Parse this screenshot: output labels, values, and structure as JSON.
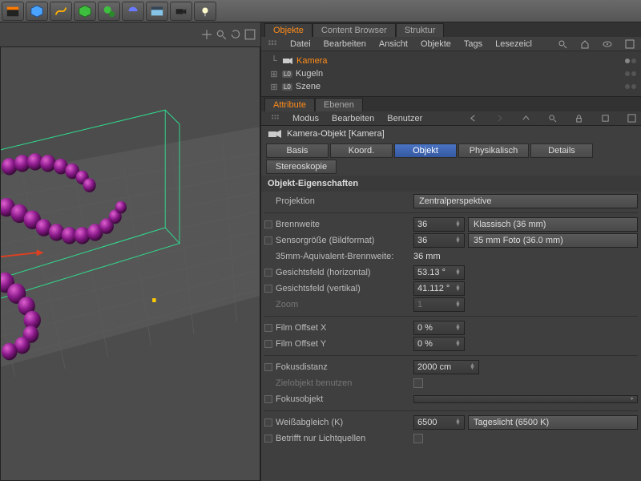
{
  "toolbar_icons": [
    "clapper",
    "cube",
    "link",
    "green-cube",
    "gears",
    "lens",
    "grid",
    "camera",
    "light"
  ],
  "tabs": {
    "objects": "Objekte",
    "content": "Content Browser",
    "structure": "Struktur"
  },
  "obj_menu": [
    "Datei",
    "Bearbeiten",
    "Ansicht",
    "Objekte",
    "Tags",
    "Lesezeicl"
  ],
  "objlist": [
    {
      "name": "Kamera",
      "selected": true,
      "icon": "camera",
      "layer": ""
    },
    {
      "name": "Kugeln",
      "selected": false,
      "icon": "null",
      "layer": "L0"
    },
    {
      "name": "Szene",
      "selected": false,
      "icon": "null",
      "layer": "L0"
    }
  ],
  "attr_tabs": {
    "attribute": "Attribute",
    "ebenen": "Ebenen"
  },
  "attr_menu": [
    "Modus",
    "Bearbeiten",
    "Benutzer"
  ],
  "obj_title": "Kamera-Objekt [Kamera]",
  "subtabs": {
    "basis": "Basis",
    "koord": "Koord.",
    "objekt": "Objekt",
    "phys": "Physikalisch",
    "details": "Details",
    "stereo": "Stereoskopie"
  },
  "section": "Objekt-Eigenschaften",
  "labels": {
    "projektion": "Projektion",
    "brennweite": "Brennweite",
    "sensor": "Sensorgröße (Bildformat)",
    "equiv": "35mm-Äquivalent-Brennweite:",
    "gfh": "Gesichtsfeld (horizontal)",
    "gfv": "Gesichtsfeld (vertikal)",
    "zoom": "Zoom",
    "fox": "Film Offset X",
    "foy": "Film Offset Y",
    "fokus": "Fokusdistanz",
    "ziel": "Zielobjekt benutzen",
    "fobj": "Fokusobjekt",
    "wb": "Weißabgleich (K)",
    "licht": "Betrifft nur Lichtquellen"
  },
  "values": {
    "projektion": "Zentralperspektive",
    "brennweite": "36",
    "brennweite_dd": "Klassisch (36 mm)",
    "sensor": "36",
    "sensor_dd": "35 mm Foto (36.0 mm)",
    "equiv": "36 mm",
    "gfh": "53.13 °",
    "gfv": "41.112 °",
    "zoom": "1",
    "fox": "0 %",
    "foy": "0 %",
    "fokus": "2000 cm",
    "wb": "6500",
    "wb_dd": "Tageslicht (6500 K)"
  }
}
